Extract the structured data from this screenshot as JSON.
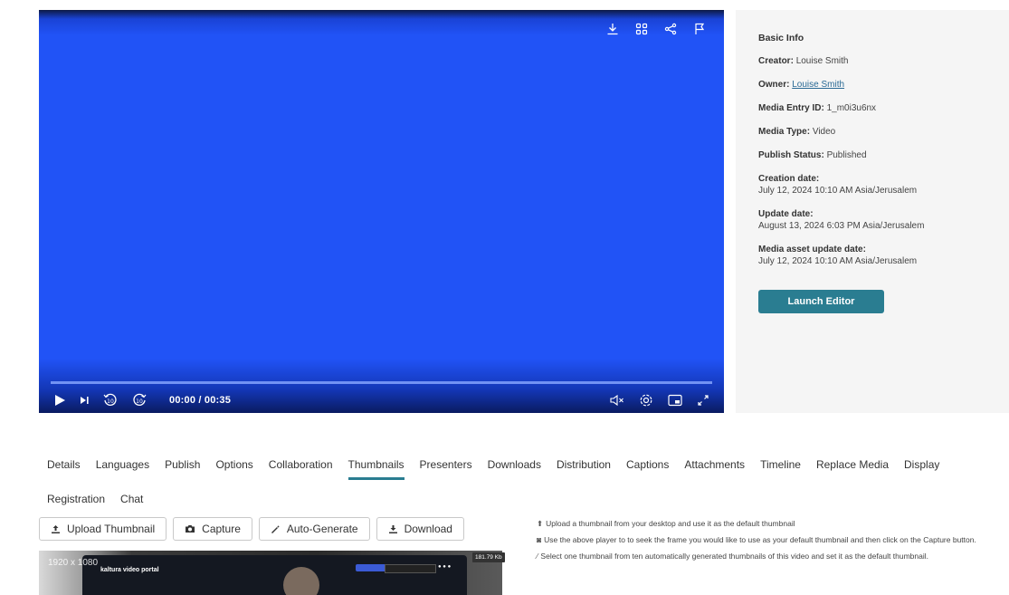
{
  "player": {
    "time": "00:00 / 00:35",
    "top_icons": [
      "download-icon",
      "grid-icon",
      "share-icon",
      "flag-icon"
    ],
    "controls_left": [
      "play-icon",
      "next-icon",
      "rewind-10-icon",
      "forward-10-icon"
    ],
    "controls_right": [
      "mute-icon",
      "settings-icon",
      "pip-icon",
      "fullscreen-icon"
    ],
    "progress": 0,
    "background_color": "#2153f6"
  },
  "info": {
    "title": "Basic Info",
    "creator_label": "Creator:",
    "creator_value": "Louise Smith",
    "owner_label": "Owner:",
    "owner_value": "Louise Smith",
    "entry_label": "Media Entry ID:",
    "entry_value": "1_m0i3u6nx",
    "type_label": "Media Type:",
    "type_value": "Video",
    "status_label": "Publish Status:",
    "status_value": "Published",
    "creation_label": "Creation date:",
    "creation_value": "July 12, 2024 10:10 AM Asia/Jerusalem",
    "update_label": "Update date:",
    "update_value": "August 13, 2024 6:03 PM Asia/Jerusalem",
    "asset_label": "Media asset update date:",
    "asset_value": "July 12, 2024 10:10 AM Asia/Jerusalem",
    "launch_label": "Launch Editor",
    "accent_color": "#2a7d91"
  },
  "tabs": {
    "row1": [
      "Details",
      "Languages",
      "Publish",
      "Options",
      "Collaboration",
      "Thumbnails",
      "Presenters",
      "Downloads",
      "Distribution",
      "Captions",
      "Attachments",
      "Timeline",
      "Replace Media",
      "Display"
    ],
    "row2": [
      "Registration",
      "Chat"
    ],
    "active": "Thumbnails"
  },
  "buttons": {
    "upload": "Upload Thumbnail",
    "capture": "Capture",
    "autogen": "Auto-Generate",
    "download": "Download"
  },
  "thumbnail": {
    "dims": "1920 x 1080",
    "size": "181.79 Kb",
    "logo_text": "kaltura video portal"
  },
  "help": {
    "upload": "Upload a thumbnail from your desktop and use it as the default thumbnail",
    "capture": "Use the above player to to seek the frame you would like to use as your default thumbnail and then click on the Capture button.",
    "autogen": "Select one thumbnail from ten automatically generated thumbnails of this video and set it as the default thumbnail."
  }
}
